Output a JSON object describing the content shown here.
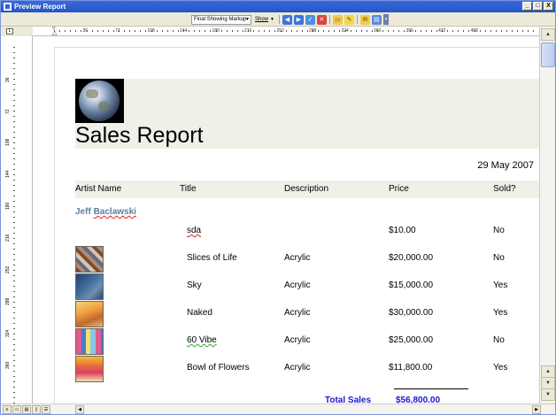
{
  "window": {
    "title": "Preview Report",
    "min": "_",
    "max": "□",
    "close": "X"
  },
  "toolbar": {
    "markup_select": "Final Showing Markup",
    "show_label": "Show",
    "icon_names": [
      "prev-change-icon",
      "next-change-icon",
      "accept-icon",
      "reject-icon",
      "comment-icon",
      "highlight-icon",
      "track-icon",
      "reviewing-pane-icon"
    ]
  },
  "ruler": {
    "h_labels": [
      "36",
      "72",
      "108",
      "144",
      "180",
      "216",
      "252",
      "288",
      "324",
      "360",
      "396",
      "432",
      "468"
    ],
    "v_labels": [
      "36",
      "72",
      "108",
      "144",
      "180",
      "216",
      "252",
      "288",
      "324",
      "360"
    ]
  },
  "report": {
    "title": "Sales Report",
    "date": "29 May 2007",
    "columns": [
      "Artist Name",
      "Title",
      "Description",
      "Price",
      "Sold?"
    ],
    "artist_first": "Jeff",
    "artist_last": "Baclawski",
    "rows": [
      {
        "title": "sda",
        "description": "",
        "price": "$10.00",
        "sold": "No",
        "thumb": false
      },
      {
        "title": "Slices of Life",
        "description": "Acrylic",
        "price": "$20,000.00",
        "sold": "No",
        "thumb": true
      },
      {
        "title": "Sky",
        "description": "Acrylic",
        "price": "$15,000.00",
        "sold": "Yes",
        "thumb": true
      },
      {
        "title": "Naked",
        "description": "Acrylic",
        "price": "$30,000.00",
        "sold": "Yes",
        "thumb": true
      },
      {
        "title": "60 Vibe",
        "description": "Acrylic",
        "price": "$25,000.00",
        "sold": "No",
        "thumb": true
      },
      {
        "title": "Bowl of Flowers",
        "description": "Acrylic",
        "price": "$11,800.00",
        "sold": "Yes",
        "thumb": true
      }
    ],
    "total_label": "Total Sales",
    "total_value": "$56,800.00"
  },
  "colors": {
    "titlebar": "#2455c8",
    "artist": "#5a7fa0",
    "total": "#1a1acc",
    "band": "#f0f0e8"
  }
}
